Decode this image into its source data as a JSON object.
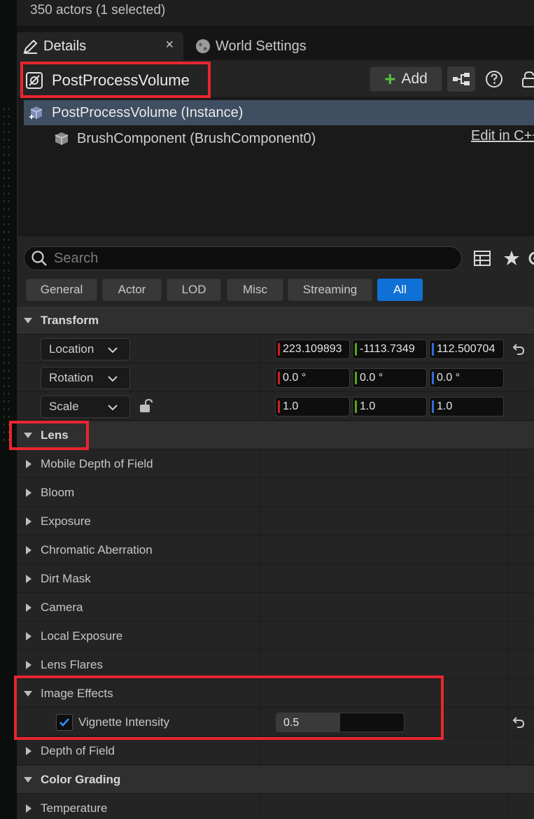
{
  "outliner": {
    "actor_count": "350 actors (1 selected)"
  },
  "tabs": [
    {
      "label": "Details",
      "icon": "pencil-icon",
      "active": true
    },
    {
      "label": "World Settings",
      "icon": "globe-icon",
      "active": false
    }
  ],
  "actor": {
    "name": "PostProcessVolume",
    "add_label": "Add"
  },
  "components": [
    {
      "label": "PostProcessVolume (Instance)",
      "selected": true
    },
    {
      "label": "BrushComponent (BrushComponent0)",
      "selected": false
    }
  ],
  "edit_cpp": "Edit in C++",
  "search": {
    "placeholder": "Search",
    "value": ""
  },
  "filters": [
    "General",
    "Actor",
    "LOD",
    "Misc",
    "Streaming",
    "All"
  ],
  "active_filter": "All",
  "transform": {
    "category": "Transform",
    "location": {
      "label": "Location",
      "x": "223.109893",
      "y": "-1113.7349",
      "z": "112.500704"
    },
    "rotation": {
      "label": "Rotation",
      "x": "0.0 °",
      "y": "0.0 °",
      "z": "0.0 °"
    },
    "scale": {
      "label": "Scale",
      "x": "1.0",
      "y": "1.0",
      "z": "1.0"
    }
  },
  "lens": {
    "category": "Lens",
    "groups": [
      "Mobile Depth of Field",
      "Bloom",
      "Exposure",
      "Chromatic Aberration",
      "Dirt Mask",
      "Camera",
      "Local Exposure",
      "Lens Flares"
    ],
    "image_effects": {
      "label": "Image Effects",
      "vignette_label": "Vignette Intensity",
      "vignette_value": "0.5",
      "vignette_enabled": true,
      "vignette_fraction": 0.5
    },
    "depth_of_field": "Depth of Field"
  },
  "color_grading": {
    "category": "Color Grading",
    "groups": [
      "Temperature"
    ]
  },
  "colors": {
    "accent": "#0f70d6",
    "highlight": "#e8262f",
    "axis_x": "#c8231c",
    "axis_y": "#5aa01f",
    "axis_z": "#2f6fd6",
    "selection": "#3f4e61"
  }
}
